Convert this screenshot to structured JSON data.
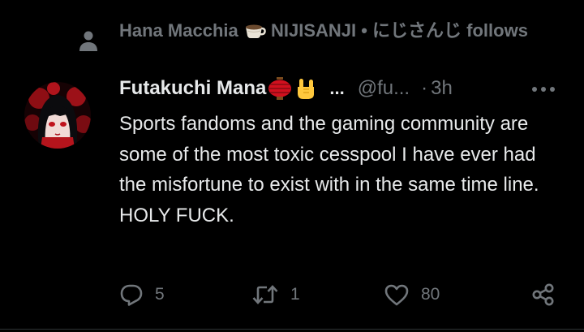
{
  "social_context": {
    "icon": "person-icon",
    "name": "Hana Macchia",
    "badge_emoji": "coffee-cup-emoji",
    "suffix": " NIJISANJI • にじさんじ follows"
  },
  "author": {
    "display_name": "Futakuchi Mana",
    "emoji_1": "red-lantern-emoji",
    "emoji_2": "rock-on-hand-emoji",
    "ellipsis": "...",
    "handle": "@fu...",
    "separator": "·",
    "time": "3h"
  },
  "tweet": {
    "text": "Sports fandoms and the gaming community are some of the most toxic cesspool I have ever had the misfortune to exist with in the same time line. HOLY FUCK."
  },
  "actions": {
    "replies": "5",
    "retweets": "1",
    "likes": "80"
  },
  "icons": {
    "more": "more-horizontal-icon",
    "reply": "reply-icon",
    "retweet": "retweet-icon",
    "like": "heart-icon",
    "share": "share-icon"
  },
  "colors": {
    "background": "#000000",
    "text_primary": "#e7e9ea",
    "text_secondary": "#71767b",
    "divider": "#2f3336"
  }
}
